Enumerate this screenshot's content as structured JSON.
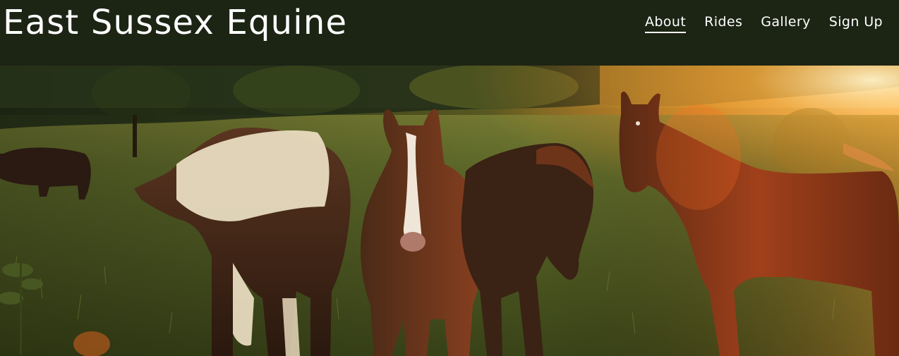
{
  "header": {
    "site_title": "East Sussex Equine",
    "background": "#1c2414",
    "nav": [
      {
        "label": "About",
        "active": true
      },
      {
        "label": "Rides",
        "active": false
      },
      {
        "label": "Gallery",
        "active": false
      },
      {
        "label": "Sign Up",
        "active": false
      }
    ]
  },
  "hero": {
    "image": "horses-in-field-photo"
  }
}
